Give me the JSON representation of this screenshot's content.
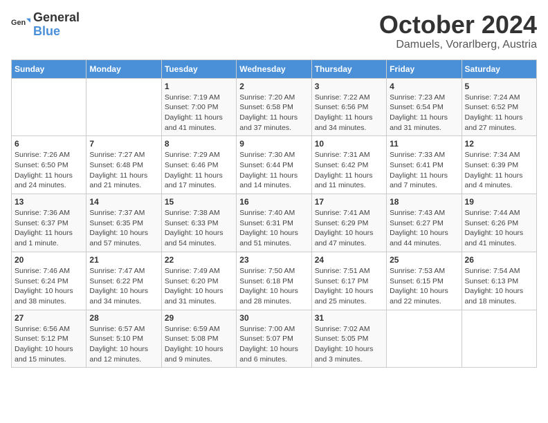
{
  "header": {
    "logo_general": "General",
    "logo_blue": "Blue",
    "month_title": "October 2024",
    "location": "Damuels, Vorarlberg, Austria"
  },
  "days_of_week": [
    "Sunday",
    "Monday",
    "Tuesday",
    "Wednesday",
    "Thursday",
    "Friday",
    "Saturday"
  ],
  "weeks": [
    [
      {
        "day": "",
        "info": ""
      },
      {
        "day": "",
        "info": ""
      },
      {
        "day": "1",
        "info": "Sunrise: 7:19 AM\nSunset: 7:00 PM\nDaylight: 11 hours and 41 minutes."
      },
      {
        "day": "2",
        "info": "Sunrise: 7:20 AM\nSunset: 6:58 PM\nDaylight: 11 hours and 37 minutes."
      },
      {
        "day": "3",
        "info": "Sunrise: 7:22 AM\nSunset: 6:56 PM\nDaylight: 11 hours and 34 minutes."
      },
      {
        "day": "4",
        "info": "Sunrise: 7:23 AM\nSunset: 6:54 PM\nDaylight: 11 hours and 31 minutes."
      },
      {
        "day": "5",
        "info": "Sunrise: 7:24 AM\nSunset: 6:52 PM\nDaylight: 11 hours and 27 minutes."
      }
    ],
    [
      {
        "day": "6",
        "info": "Sunrise: 7:26 AM\nSunset: 6:50 PM\nDaylight: 11 hours and 24 minutes."
      },
      {
        "day": "7",
        "info": "Sunrise: 7:27 AM\nSunset: 6:48 PM\nDaylight: 11 hours and 21 minutes."
      },
      {
        "day": "8",
        "info": "Sunrise: 7:29 AM\nSunset: 6:46 PM\nDaylight: 11 hours and 17 minutes."
      },
      {
        "day": "9",
        "info": "Sunrise: 7:30 AM\nSunset: 6:44 PM\nDaylight: 11 hours and 14 minutes."
      },
      {
        "day": "10",
        "info": "Sunrise: 7:31 AM\nSunset: 6:42 PM\nDaylight: 11 hours and 11 minutes."
      },
      {
        "day": "11",
        "info": "Sunrise: 7:33 AM\nSunset: 6:41 PM\nDaylight: 11 hours and 7 minutes."
      },
      {
        "day": "12",
        "info": "Sunrise: 7:34 AM\nSunset: 6:39 PM\nDaylight: 11 hours and 4 minutes."
      }
    ],
    [
      {
        "day": "13",
        "info": "Sunrise: 7:36 AM\nSunset: 6:37 PM\nDaylight: 11 hours and 1 minute."
      },
      {
        "day": "14",
        "info": "Sunrise: 7:37 AM\nSunset: 6:35 PM\nDaylight: 10 hours and 57 minutes."
      },
      {
        "day": "15",
        "info": "Sunrise: 7:38 AM\nSunset: 6:33 PM\nDaylight: 10 hours and 54 minutes."
      },
      {
        "day": "16",
        "info": "Sunrise: 7:40 AM\nSunset: 6:31 PM\nDaylight: 10 hours and 51 minutes."
      },
      {
        "day": "17",
        "info": "Sunrise: 7:41 AM\nSunset: 6:29 PM\nDaylight: 10 hours and 47 minutes."
      },
      {
        "day": "18",
        "info": "Sunrise: 7:43 AM\nSunset: 6:27 PM\nDaylight: 10 hours and 44 minutes."
      },
      {
        "day": "19",
        "info": "Sunrise: 7:44 AM\nSunset: 6:26 PM\nDaylight: 10 hours and 41 minutes."
      }
    ],
    [
      {
        "day": "20",
        "info": "Sunrise: 7:46 AM\nSunset: 6:24 PM\nDaylight: 10 hours and 38 minutes."
      },
      {
        "day": "21",
        "info": "Sunrise: 7:47 AM\nSunset: 6:22 PM\nDaylight: 10 hours and 34 minutes."
      },
      {
        "day": "22",
        "info": "Sunrise: 7:49 AM\nSunset: 6:20 PM\nDaylight: 10 hours and 31 minutes."
      },
      {
        "day": "23",
        "info": "Sunrise: 7:50 AM\nSunset: 6:18 PM\nDaylight: 10 hours and 28 minutes."
      },
      {
        "day": "24",
        "info": "Sunrise: 7:51 AM\nSunset: 6:17 PM\nDaylight: 10 hours and 25 minutes."
      },
      {
        "day": "25",
        "info": "Sunrise: 7:53 AM\nSunset: 6:15 PM\nDaylight: 10 hours and 22 minutes."
      },
      {
        "day": "26",
        "info": "Sunrise: 7:54 AM\nSunset: 6:13 PM\nDaylight: 10 hours and 18 minutes."
      }
    ],
    [
      {
        "day": "27",
        "info": "Sunrise: 6:56 AM\nSunset: 5:12 PM\nDaylight: 10 hours and 15 minutes."
      },
      {
        "day": "28",
        "info": "Sunrise: 6:57 AM\nSunset: 5:10 PM\nDaylight: 10 hours and 12 minutes."
      },
      {
        "day": "29",
        "info": "Sunrise: 6:59 AM\nSunset: 5:08 PM\nDaylight: 10 hours and 9 minutes."
      },
      {
        "day": "30",
        "info": "Sunrise: 7:00 AM\nSunset: 5:07 PM\nDaylight: 10 hours and 6 minutes."
      },
      {
        "day": "31",
        "info": "Sunrise: 7:02 AM\nSunset: 5:05 PM\nDaylight: 10 hours and 3 minutes."
      },
      {
        "day": "",
        "info": ""
      },
      {
        "day": "",
        "info": ""
      }
    ]
  ]
}
